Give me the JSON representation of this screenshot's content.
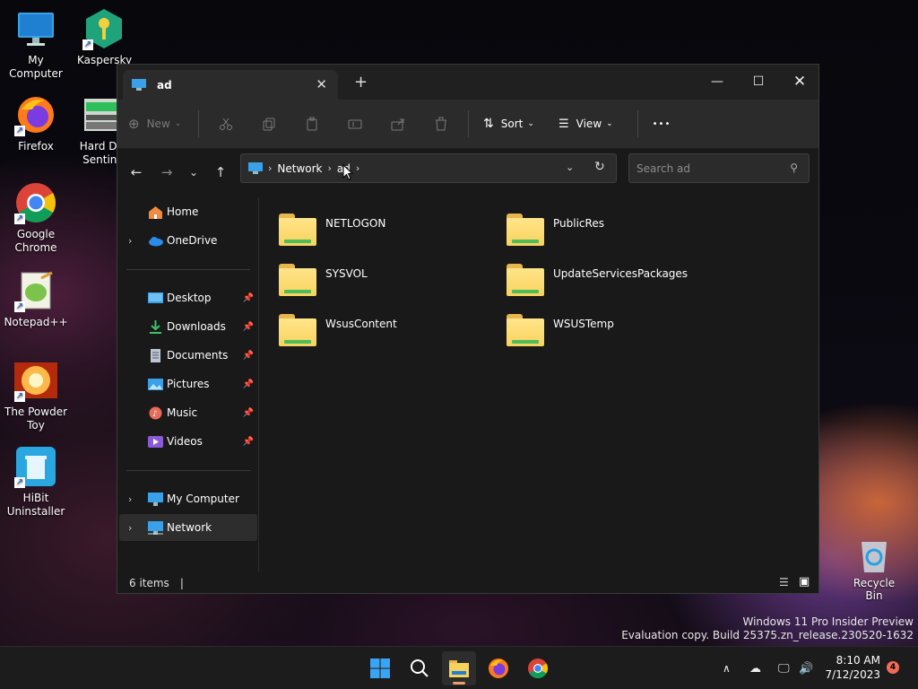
{
  "desktop": {
    "icons": [
      {
        "label": "My Computer"
      },
      {
        "label": "Kaspersky Passwo..."
      },
      {
        "label": "Firefox"
      },
      {
        "label": "Hard Di... Sentin..."
      },
      {
        "label": "Google Chrome"
      },
      {
        "label": "Notepad++"
      },
      {
        "label": "The Powder Toy"
      },
      {
        "label": "HiBit Uninstaller"
      }
    ],
    "recycle_bin": "Recycle Bin",
    "watermark_line1": "Windows 11 Pro Insider Preview",
    "watermark_line2": "Evaluation copy. Build 25375.zn_release.230520-1632"
  },
  "window": {
    "tab_title": "ad",
    "commands": {
      "new": "New",
      "sort": "Sort",
      "view": "View",
      "more": "•••"
    },
    "address": {
      "crumbs": [
        "Network",
        "ad"
      ]
    },
    "search": {
      "placeholder": "Search ad"
    },
    "sidebar": {
      "home": "Home",
      "onedrive": "OneDrive",
      "desktop": "Desktop",
      "downloads": "Downloads",
      "documents": "Documents",
      "pictures": "Pictures",
      "music": "Music",
      "videos": "Videos",
      "my_computer": "My Computer",
      "network": "Network"
    },
    "folders": [
      {
        "name": "NETLOGON"
      },
      {
        "name": "PublicRes"
      },
      {
        "name": "SYSVOL"
      },
      {
        "name": "UpdateServicesPackages"
      },
      {
        "name": "WsusContent"
      },
      {
        "name": "WSUSTemp"
      }
    ],
    "status": {
      "items": "6 items",
      "caret": "|"
    }
  },
  "taskbar": {
    "time": "8:10 AM",
    "date": "7/12/2023",
    "notifications": "4"
  },
  "colors": {
    "window_bg": "#191919",
    "command_bar": "#2b2b2b",
    "folder_yellow": "#f9d25d",
    "accent": "#e8a067"
  }
}
